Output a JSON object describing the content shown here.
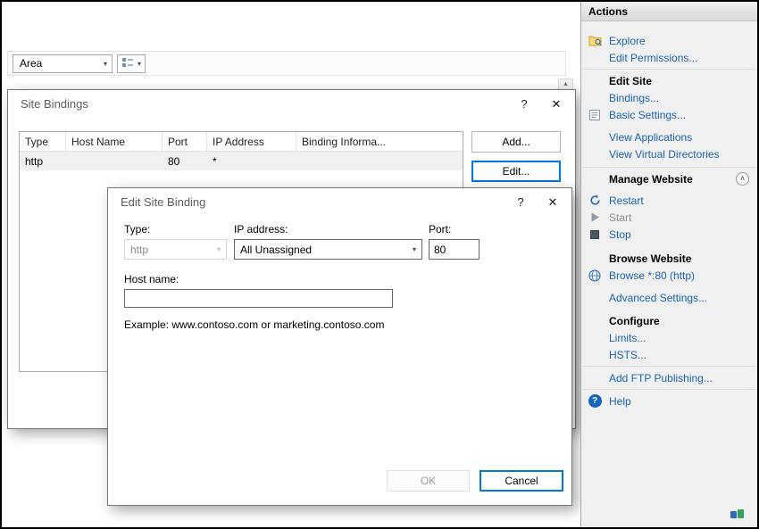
{
  "toolbar": {
    "area_label": "Area"
  },
  "icons": {
    "combo_arrow": "▾",
    "scroll_up": "▲",
    "help_glyph": "?",
    "close_glyph": "✕",
    "collapse_glyph": "∧",
    "help_badge_glyph": "?"
  },
  "site_bindings": {
    "title": "Site Bindings",
    "columns": [
      "Type",
      "Host Name",
      "Port",
      "IP Address",
      "Binding Informa..."
    ],
    "row": {
      "type": "http",
      "host_name": "",
      "port": "80",
      "ip_address": "*",
      "binding_info": ""
    },
    "add_label": "Add...",
    "edit_label": "Edit..."
  },
  "edit_binding": {
    "title": "Edit Site Binding",
    "type_label": "Type:",
    "type_value": "http",
    "ip_label": "IP address:",
    "ip_value": "All Unassigned",
    "port_label": "Port:",
    "port_value": "80",
    "host_label": "Host name:",
    "host_value": "",
    "example_text": "Example: www.contoso.com or marketing.contoso.com",
    "ok_label": "OK",
    "cancel_label": "Cancel"
  },
  "actions": {
    "title": "Actions",
    "explore": "Explore",
    "edit_permissions": "Edit Permissions...",
    "edit_site_header": "Edit Site",
    "bindings": "Bindings...",
    "basic_settings": "Basic Settings...",
    "view_applications": "View Applications",
    "view_virtual_directories": "View Virtual Directories",
    "manage_website_header": "Manage Website",
    "restart": "Restart",
    "start": "Start",
    "stop": "Stop",
    "browse_website_header": "Browse Website",
    "browse_site": "Browse *:80 (http)",
    "advanced_settings": "Advanced Settings...",
    "configure_header": "Configure",
    "limits": "Limits...",
    "hsts": "HSTS...",
    "add_ftp_publishing": "Add FTP Publishing...",
    "help": "Help"
  },
  "colors": {
    "action_link_blue": "#1b63b6",
    "focus_border_blue": "#0078d7",
    "selected_row_gray": "#f0f0f0"
  }
}
